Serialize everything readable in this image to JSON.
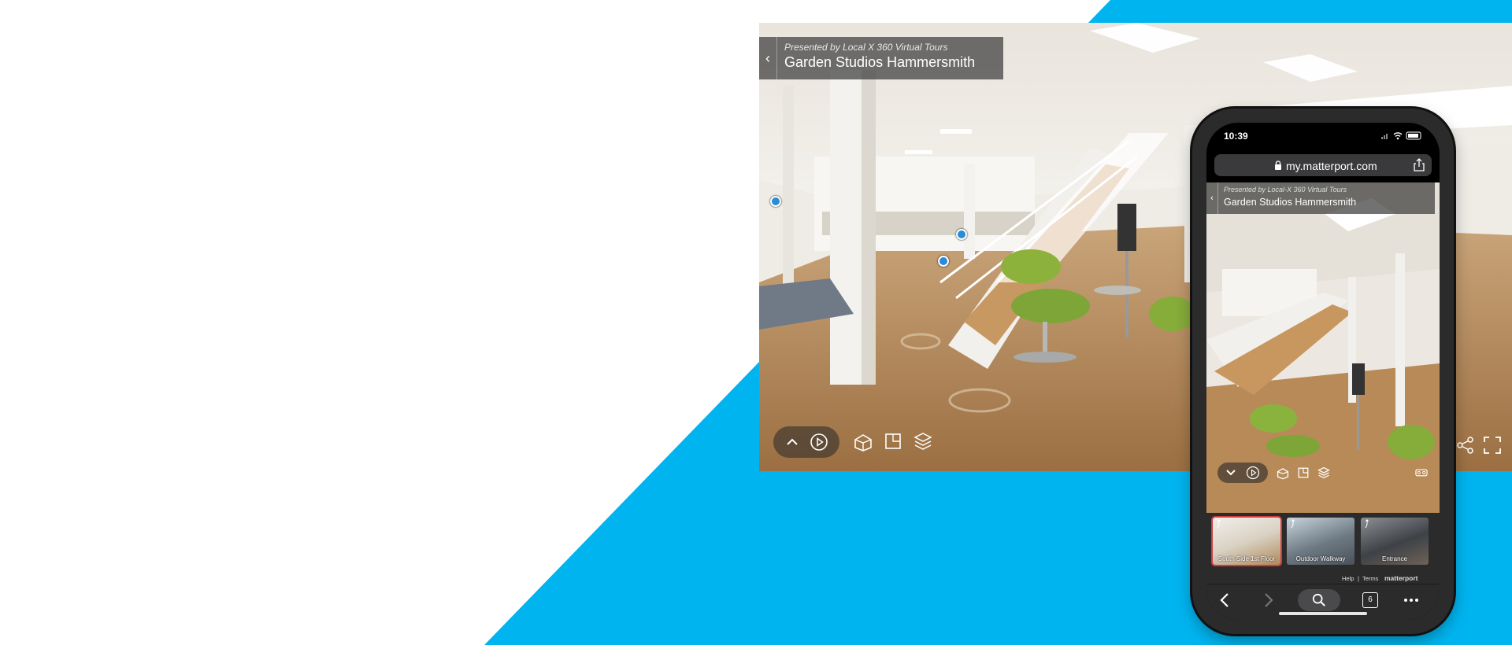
{
  "colors": {
    "accent_blue": "#00b4ef",
    "background": "#ffffff",
    "overlay": "#3c3c3c"
  },
  "tour": {
    "presented_by": "Presented by Local X 360 Virtual Tours",
    "title": "Garden Studios Hammersmith",
    "controls": [
      {
        "icon": "chevron-up-icon"
      },
      {
        "icon": "play-icon"
      },
      {
        "icon": "dollhouse-icon"
      },
      {
        "icon": "floorplan-icon"
      },
      {
        "icon": "floors-icon"
      },
      {
        "icon": "share-icon"
      },
      {
        "icon": "fullscreen-icon"
      }
    ]
  },
  "phone": {
    "time": "10:39",
    "url": "my.matterport.com",
    "presented_by": "Presented by Local-X 360 Virtual Tours",
    "title": "Garden Studios Hammersmith",
    "highlights": [
      {
        "label": "South Side 1st Floor",
        "active": true
      },
      {
        "label": "Outdoor Walkway",
        "active": false
      },
      {
        "label": "Entrance",
        "active": false
      }
    ],
    "footer": {
      "help": "Help",
      "separator": "|",
      "terms": "Terms",
      "brand": "matterport"
    },
    "tabs_count": "6"
  }
}
